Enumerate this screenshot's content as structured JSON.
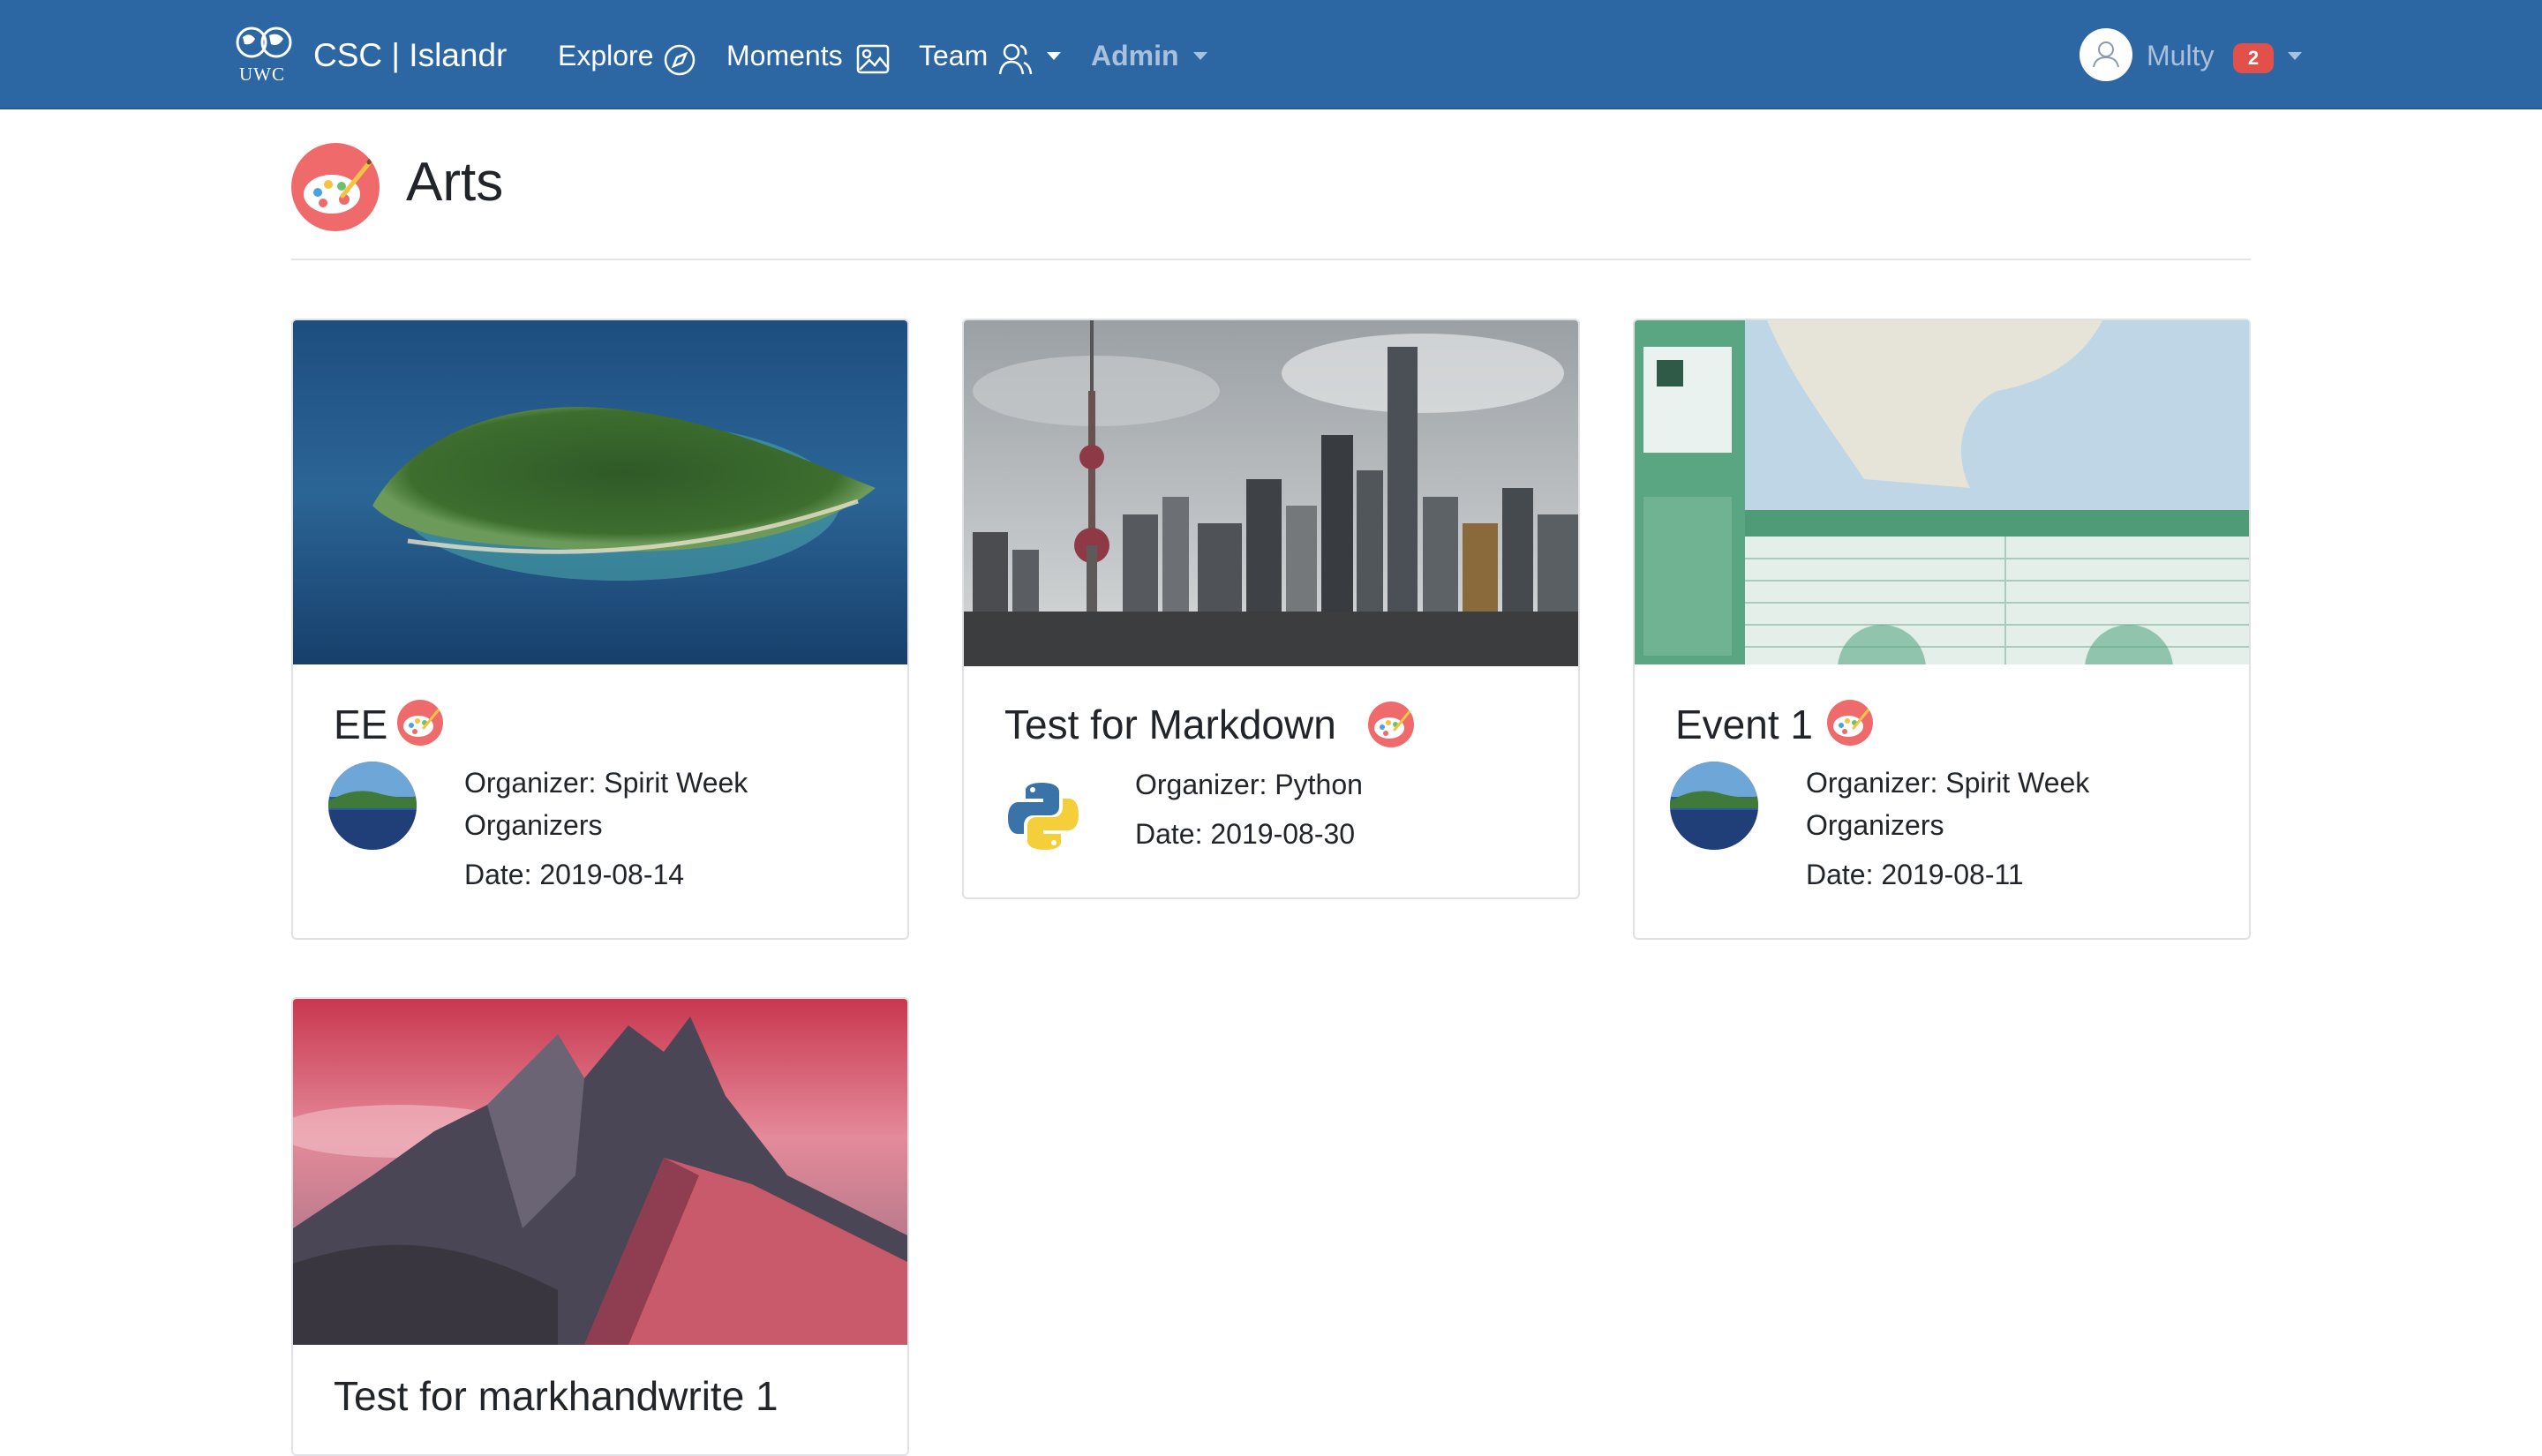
{
  "navbar": {
    "brand_logo_text": "UWC",
    "brand_title": "CSC | Islandr",
    "links": [
      {
        "label": "Explore",
        "icon": "compass-icon"
      },
      {
        "label": "Moments",
        "icon": "image-icon"
      },
      {
        "label": "Team",
        "icon": "users-icon"
      },
      {
        "label": "Admin"
      }
    ],
    "user": {
      "name": "Multy",
      "badge": "2"
    }
  },
  "page": {
    "title": "Arts",
    "icon": "palette-icon"
  },
  "cards": [
    {
      "title": "EE",
      "organizer": "Organizer: Spirit Week Organizers",
      "date": "Date: 2019-08-14",
      "image": "island-photo"
    },
    {
      "title": "Test for Markdown",
      "organizer": "Organizer: Python",
      "date": "Date: 2019-08-30",
      "image": "city-skyline-photo"
    },
    {
      "title": "Event 1",
      "organizer": "Organizer: Spirit Week Organizers",
      "date": "Date: 2019-08-11",
      "image": "map-infographic"
    },
    {
      "title": "Test for markhandwrite 1",
      "image": "mountain-photo"
    }
  ],
  "colors": {
    "navbar": "#2c67a3",
    "accent_palette": "#ef6b6b",
    "badge": "#e2504a"
  }
}
